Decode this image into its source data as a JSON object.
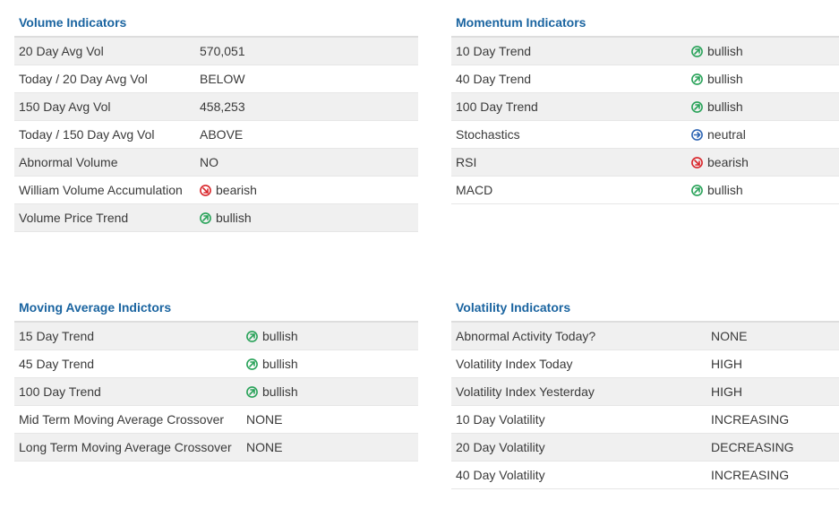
{
  "colors": {
    "title": "#1a64a0",
    "bullish": "#2aa35a",
    "bearish": "#d9262b",
    "neutral": "#2f66b4",
    "row_shade": "#f0f0f0"
  },
  "volume": {
    "title": "Volume Indicators",
    "rows": [
      {
        "label": "20 Day Avg Vol",
        "value": "570,051"
      },
      {
        "label": "Today / 20 Day Avg Vol",
        "value": "BELOW"
      },
      {
        "label": "150 Day Avg Vol",
        "value": "458,253"
      },
      {
        "label": "Today / 150 Day Avg Vol",
        "value": "ABOVE"
      },
      {
        "label": "Abnormal Volume",
        "value": "NO"
      },
      {
        "label": "William Volume Accumulation",
        "value": "bearish",
        "icon": "bearish-arrow-icon"
      },
      {
        "label": "Volume Price Trend",
        "value": "bullish",
        "icon": "bullish-arrow-icon"
      }
    ]
  },
  "momentum": {
    "title": "Momentum Indicators",
    "rows": [
      {
        "label": "10 Day Trend",
        "value": "bullish",
        "icon": "bullish-arrow-icon"
      },
      {
        "label": "40 Day Trend",
        "value": "bullish",
        "icon": "bullish-arrow-icon"
      },
      {
        "label": "100 Day Trend",
        "value": "bullish",
        "icon": "bullish-arrow-icon"
      },
      {
        "label": "Stochastics",
        "value": "neutral",
        "icon": "neutral-arrow-icon"
      },
      {
        "label": "RSI",
        "value": "bearish",
        "icon": "bearish-arrow-icon"
      },
      {
        "label": "MACD",
        "value": "bullish",
        "icon": "bullish-arrow-icon"
      }
    ]
  },
  "moving_average": {
    "title": "Moving Average Indictors",
    "rows": [
      {
        "label": "15 Day Trend",
        "value": "bullish",
        "icon": "bullish-arrow-icon"
      },
      {
        "label": "45 Day Trend",
        "value": "bullish",
        "icon": "bullish-arrow-icon"
      },
      {
        "label": "100 Day Trend",
        "value": "bullish",
        "icon": "bullish-arrow-icon"
      },
      {
        "label": "Mid Term Moving Average Crossover",
        "value": "NONE"
      },
      {
        "label": "Long Term Moving Average Crossover",
        "value": "NONE"
      }
    ]
  },
  "volatility": {
    "title": "Volatility Indicators",
    "rows": [
      {
        "label": "Abnormal Activity Today?",
        "value": "NONE"
      },
      {
        "label": "Volatility Index Today",
        "value": "HIGH"
      },
      {
        "label": "Volatility Index Yesterday",
        "value": "HIGH"
      },
      {
        "label": "10 Day Volatility",
        "value": "INCREASING"
      },
      {
        "label": "20 Day Volatility",
        "value": "DECREASING"
      },
      {
        "label": "40 Day Volatility",
        "value": "INCREASING"
      }
    ]
  }
}
